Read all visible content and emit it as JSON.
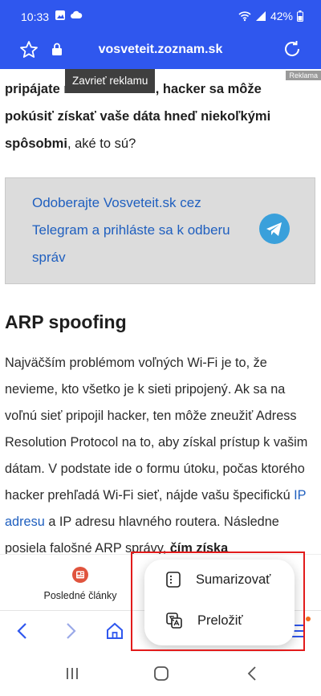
{
  "status": {
    "time": "10:33",
    "battery": "42%"
  },
  "browser": {
    "url": "vosveteit.zoznam.sk"
  },
  "ad": {
    "close_label": "Zavrieť reklamu",
    "label": "Reklama"
  },
  "article": {
    "intro_plain": "pripájate na voľnú Wi-Fi, hacker sa môže pokúsiť získať vaše dáta hneď niekoľkými spôsobmi",
    "intro_rest": ", aké to sú?",
    "promo_text": "Odoberajte Vosveteit.sk cez Telegram a prihláste sa k odberu správ",
    "heading": "ARP spoofing",
    "para_1": "Najväčším problémom voľných Wi-Fi je to, že nevieme, kto všetko je k sieti pripojený. Ak sa na voľnú sieť pripojil hacker, ten môže zneužiť Adress Resolution Protocol na to, aby získal prístup k vašim dátam. V podstate ide o formu útoku, počas ktorého hacker prehľadá Wi-Fi sieť, nájde vašu špecifickú ",
    "para_link": "IP adresu",
    "para_2": " a IP adresu hlavného routera. Následne posiela falošné ARP správy, ",
    "para_bold": "čím získa"
  },
  "tabbar": {
    "latest_label": "Posledné články"
  },
  "popup": {
    "summarize": "Sumarizovať",
    "translate": "Preložiť"
  },
  "colors": {
    "brand": "#2f57ee",
    "link": "#1f5fbf",
    "highlight": "#e21b1b"
  }
}
